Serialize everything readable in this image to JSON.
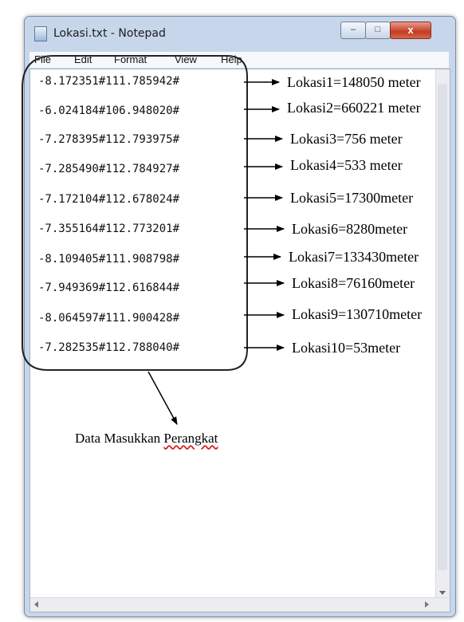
{
  "window": {
    "title": "Lokasi.txt - Notepad",
    "close_glyph": "x",
    "minimize_glyph": "–",
    "maximize_glyph": "□"
  },
  "menu": {
    "items": [
      {
        "label": "File"
      },
      {
        "label": "Edit"
      },
      {
        "label": "Format"
      },
      {
        "label": "View"
      },
      {
        "label": "Help"
      }
    ]
  },
  "lines": [
    {
      "coord": "-8.172351#111.785942#",
      "result": "Lokasi1=148050 meter"
    },
    {
      "coord": "-6.024184#106.948020#",
      "result": "Lokasi2=660221 meter"
    },
    {
      "coord": "-7.278395#112.793975#",
      "result": "Lokasi3=756 meter"
    },
    {
      "coord": "-7.285490#112.784927#",
      "result": "Lokasi4=533 meter"
    },
    {
      "coord": "-7.172104#112.678024#",
      "result": "Lokasi5=17300meter"
    },
    {
      "coord": "-7.355164#112.773201#",
      "result": "Lokasi6=8280meter"
    },
    {
      "coord": "-8.109405#111.908798#",
      "result": "Lokasi7=133430meter"
    },
    {
      "coord": "-7.949369#112.616844#",
      "result": "Lokasi8=76160meter"
    },
    {
      "coord": "-8.064597#111.900428#",
      "result": "Lokasi9=130710meter"
    },
    {
      "coord": "-7.282535#112.788040#",
      "result": "Lokasi10=53meter"
    }
  ],
  "caption": {
    "prefix": "Data Masukkan ",
    "underlined": "Perangkat"
  },
  "icons": {
    "app": "notepad-icon",
    "arrows": "right-arrow-icon"
  }
}
